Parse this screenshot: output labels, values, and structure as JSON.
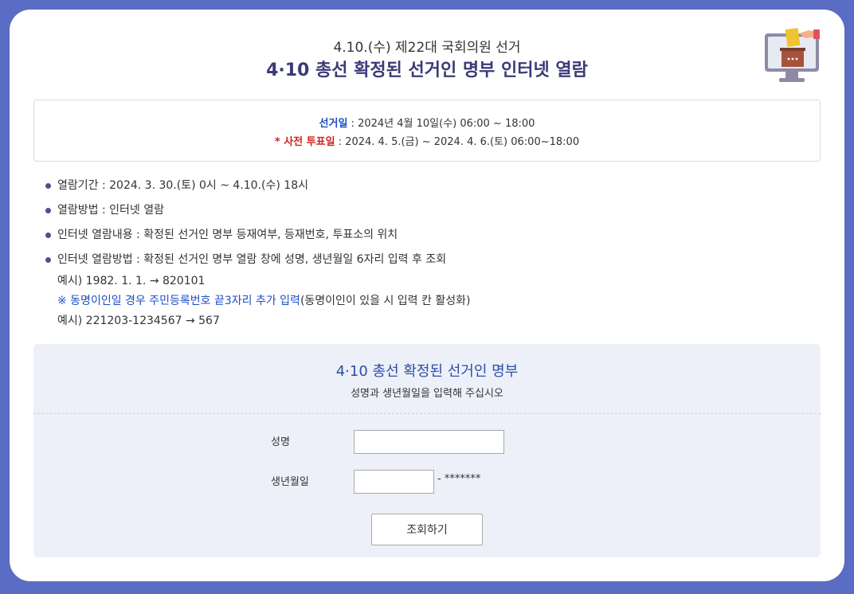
{
  "header": {
    "subtitle": "4.10.(수) 제22대 국회의원 선거",
    "title": "4·10 총선 확정된 선거인 명부 인터넷 열람"
  },
  "dates": {
    "election_label": "선거일",
    "election_value": " : 2024년 4월 10일(수) 06:00 ~ 18:00",
    "early_label": "* 사전 투표일",
    "early_value": " : 2024. 4. 5.(금) ~ 2024. 4. 6.(토) 06:00~18:00"
  },
  "info": {
    "items": [
      "열람기간 : 2024. 3. 30.(토) 0시 ~ 4.10.(수) 18시",
      "열람방법 : 인터넷 열람",
      "인터넷 열람내용 : 확정된 선거인 명부 등재여부, 등재번호, 투표소의 위치",
      "인터넷 열람방법 : 확정된 선거인 명부 열람 창에 성명, 생년월일 6자리 입력 후 조회"
    ],
    "example1": "예시) 1982. 1. 1. → 820101",
    "note_blue": "※ 동명이인일 경우 주민등록번호 끝3자리 추가 입력",
    "note_rest": "(동명이인이 있을 시 입력 칸 활성화)",
    "example2": "예시) 221203-1234567 → 567"
  },
  "form": {
    "title": "4·10 총선 확정된 선거인 명부",
    "subtitle": "성명과 생년월일을 입력해 주십시오",
    "name_label": "성명",
    "name_value": "",
    "birth_label": "생년월일",
    "birth_value": "",
    "mask": "- *******",
    "submit_label": "조회하기"
  },
  "colors": {
    "background": "#5b6cc4",
    "title": "#3b3a78",
    "accent_blue": "#1d4fc4",
    "accent_red": "#d0251c",
    "panel": "#edf0f8"
  },
  "icons": {
    "header": "monitor-ballot-box-icon",
    "bullet": "bullet-dot-icon"
  }
}
